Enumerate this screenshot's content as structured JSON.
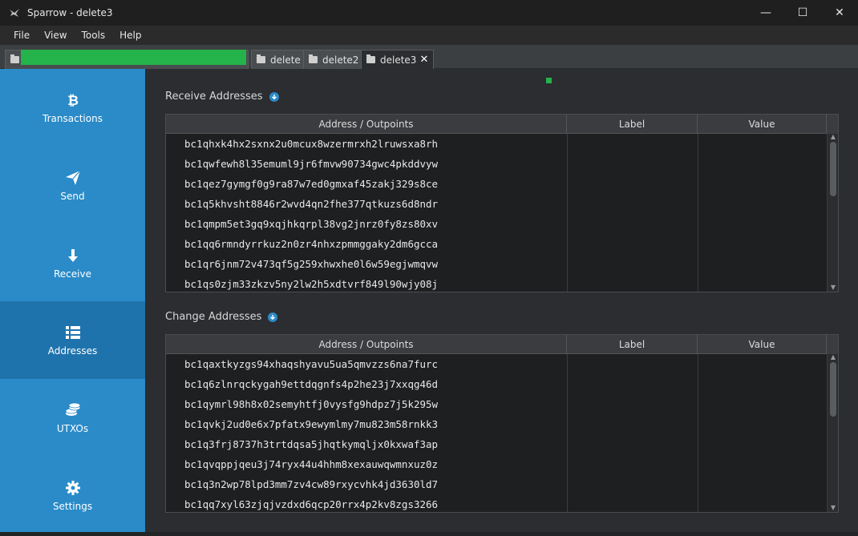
{
  "window": {
    "title": "Sparrow - delete3",
    "controls": {
      "minimize": "—",
      "maximize": "☐",
      "close": "✕"
    }
  },
  "menu": [
    "File",
    "View",
    "Tools",
    "Help"
  ],
  "tabs": [
    {
      "label": "",
      "progress": 1.0
    },
    {
      "label": "delete"
    },
    {
      "label": "delete2"
    },
    {
      "label": "delete3",
      "active": true,
      "close": "✕"
    }
  ],
  "sidebar": [
    {
      "label": "Transactions",
      "icon": "bitcoin-icon"
    },
    {
      "label": "Send",
      "icon": "paper-plane-icon"
    },
    {
      "label": "Receive",
      "icon": "arrow-down-icon"
    },
    {
      "label": "Addresses",
      "icon": "list-icon",
      "selected": true
    },
    {
      "label": "UTXOs",
      "icon": "coins-icon"
    },
    {
      "label": "Settings",
      "icon": "gear-icon"
    }
  ],
  "receive": {
    "title": "Receive Addresses",
    "columns": [
      "Address / Outpoints",
      "Label",
      "Value"
    ],
    "rows": [
      "bc1qhxk4hx2sxnx2u0mcux8wzermrxh2lruwsxa8rh",
      "bc1qwfewh8l35emuml9jr6fmvw90734gwc4pkddvyw",
      "bc1qez7gymgf0g9ra87w7ed0gmxaf45zakj329s8ce",
      "bc1q5khvsht8846r2wvd4qn2fhe377qtkuzs6d8ndr",
      "bc1qmpm5et3gq9xqjhkqrpl38vg2jnrz0fy8zs80xv",
      "bc1qq6rmndyrrkuz2n0zr4nhxzpmmggaky2dm6gcca",
      "bc1qr6jnm72v473qf5g259xhwxhe0l6w59egjwmqvw",
      "bc1qs0zjm33zkzv5ny2lw2h5xdtvrf849l90wjy08j"
    ]
  },
  "change": {
    "title": "Change Addresses",
    "columns": [
      "Address / Outpoints",
      "Label",
      "Value"
    ],
    "rows": [
      "bc1qaxtkyzgs94xhaqshyavu5ua5qmvzzs6na7furc",
      "bc1q6zlnrqckygah9ettdqgnfs4p2he23j7xxqg46d",
      "bc1qymrl98h8x02semyhtfj0vysfg9hdpz7j5k295w",
      "bc1qvkj2ud0e6x7pfatx9ewymlmy7mu823m58rnkk3",
      "bc1q3frj8737h3trtdqsa5jhqtkymqljx0kxwaf3ap",
      "bc1qvqppjqeu3j74ryx44u4hhm8xexauwqwmnxuz0z",
      "bc1q3n2wp78lpd3mm7zv4cw89rxycvhk4jd3630ld7",
      "bc1qq7xyl63zjqjvzdxd6qcp20rrx4p2kv8zgs3266"
    ]
  },
  "colors": {
    "accent": "#2a8bc8",
    "selected": "#1f73ad",
    "status": "#24b34a"
  }
}
